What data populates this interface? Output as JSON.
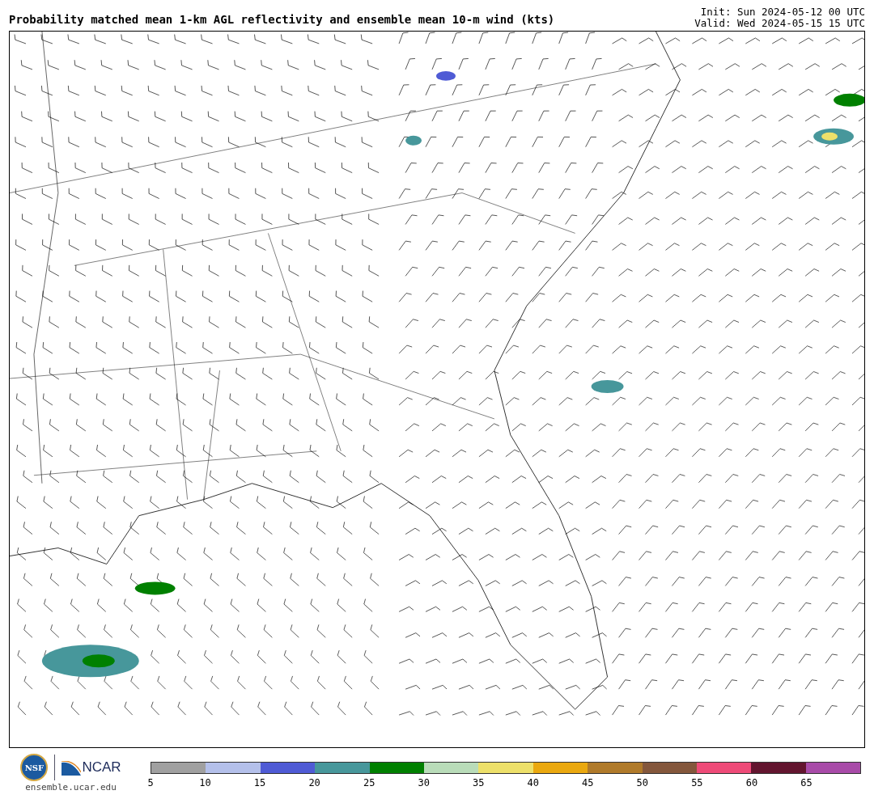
{
  "title": "Probability matched mean 1-km AGL reflectivity and ensemble mean 10-m wind (kts)",
  "init": "Init: Sun 2024-05-12 00 UTC",
  "valid": "Valid: Wed 2024-05-15 15 UTC",
  "logos": {
    "nsf": "NSF",
    "ncar": "NCAR",
    "url": "ensemble.ucar.edu"
  },
  "colorbar": {
    "segments": [
      {
        "color": "#a0a0a0"
      },
      {
        "color": "#b4c0ea"
      },
      {
        "color": "#4f5bd5"
      },
      {
        "color": "#47979b"
      },
      {
        "color": "#008000"
      },
      {
        "color": "#b9dcb9"
      },
      {
        "color": "#ede06a"
      },
      {
        "color": "#eaa80f"
      },
      {
        "color": "#b07a2a"
      },
      {
        "color": "#84573c"
      },
      {
        "color": "#ee4b78"
      },
      {
        "color": "#63152f"
      },
      {
        "color": "#a84ba8"
      }
    ],
    "ticks": [
      "5",
      "10",
      "15",
      "20",
      "25",
      "30",
      "35",
      "40",
      "45",
      "50",
      "55",
      "60",
      "65"
    ]
  }
}
